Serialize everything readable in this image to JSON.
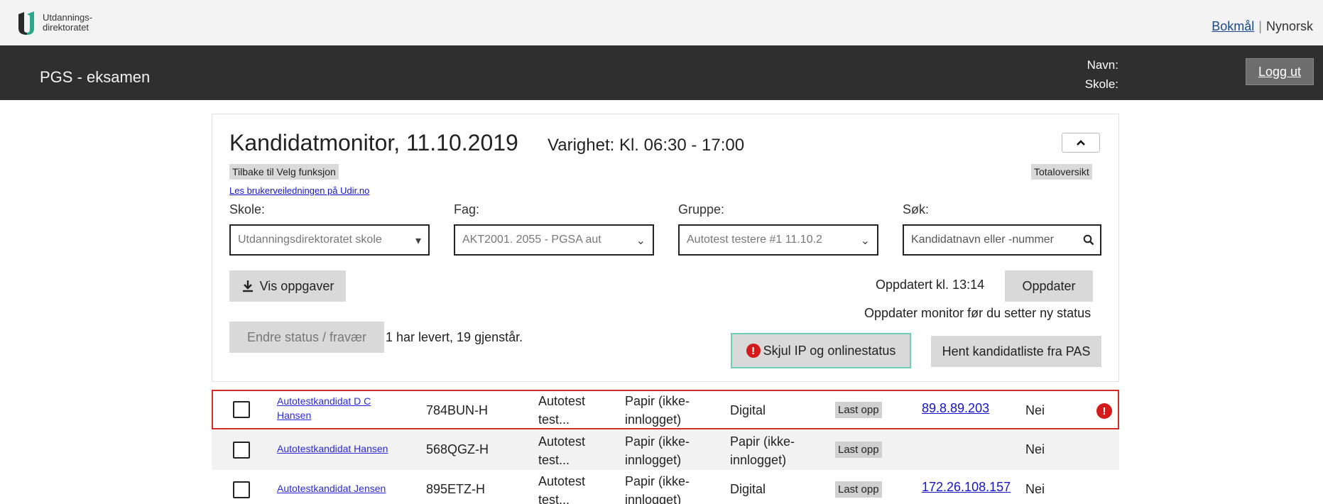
{
  "brand": {
    "logo_text": "Utdannings-\ndirektoratet"
  },
  "lang": {
    "bokmal": "Bokmål",
    "nynorsk": "Nynorsk"
  },
  "header": {
    "title": "PGS - eksamen",
    "name_label": "Navn:",
    "school_label": "Skole:",
    "logout": "Logg ut"
  },
  "monitor": {
    "title": "Kandidatmonitor, 11.10.2019",
    "duration": "Varighet: Kl. 06:30 - 17:00",
    "back_link": "Tilbake til Velg funksjon",
    "guide_link": "Les brukerveiledningen på Udir.no",
    "overview": "Totaloversikt",
    "skole_label": "Skole:",
    "fag_label": "Fag:",
    "gruppe_label": "Gruppe:",
    "sok_label": "Søk:",
    "skole_value": "Utdanningsdirektoratet skole",
    "fag_value": "AKT2001. 2055 - PGSA aut",
    "gruppe_value": "Autotest testere #1 11.10.2",
    "search_placeholder": "Kandidatnavn eller -nummer",
    "vis_oppgaver": "Vis oppgaver",
    "updated": "Oppdatert kl. 13:14",
    "oppdater": "Oppdater",
    "update_hint": "Oppdater monitor før du setter ny status",
    "endre_status": "Endre status / fravær",
    "delivered": "1 har levert, 19 gjenstår.",
    "skjul_ip": "Skjul IP og onlinestatus",
    "hent_liste": "Hent kandidatliste fra PAS"
  },
  "rows": [
    {
      "name": "Autotestkandidat D C Hansen",
      "number": "784BUN-H",
      "group": "Autotest test...",
      "status1": "Papir (ikke-innlogget)",
      "status2": "Digital",
      "upload": "Last opp",
      "ip": "89.8.89.203",
      "online": "Nei",
      "alert": true
    },
    {
      "name": "Autotestkandidat Hansen",
      "number": "568QGZ-H",
      "group": "Autotest test...",
      "status1": "Papir (ikke-innlogget)",
      "status2": "Papir (ikke-innlogget)",
      "upload": "Last opp",
      "ip": "",
      "online": "Nei",
      "alert": false
    },
    {
      "name": "Autotestkandidat Jensen",
      "number": "895ETZ-H",
      "group": "Autotest test...",
      "status1": "Papir (ikke-innlogget)",
      "status2": "Digital",
      "upload": "Last opp",
      "ip": "172.26.108.157",
      "online": "Nei",
      "alert": false
    }
  ]
}
